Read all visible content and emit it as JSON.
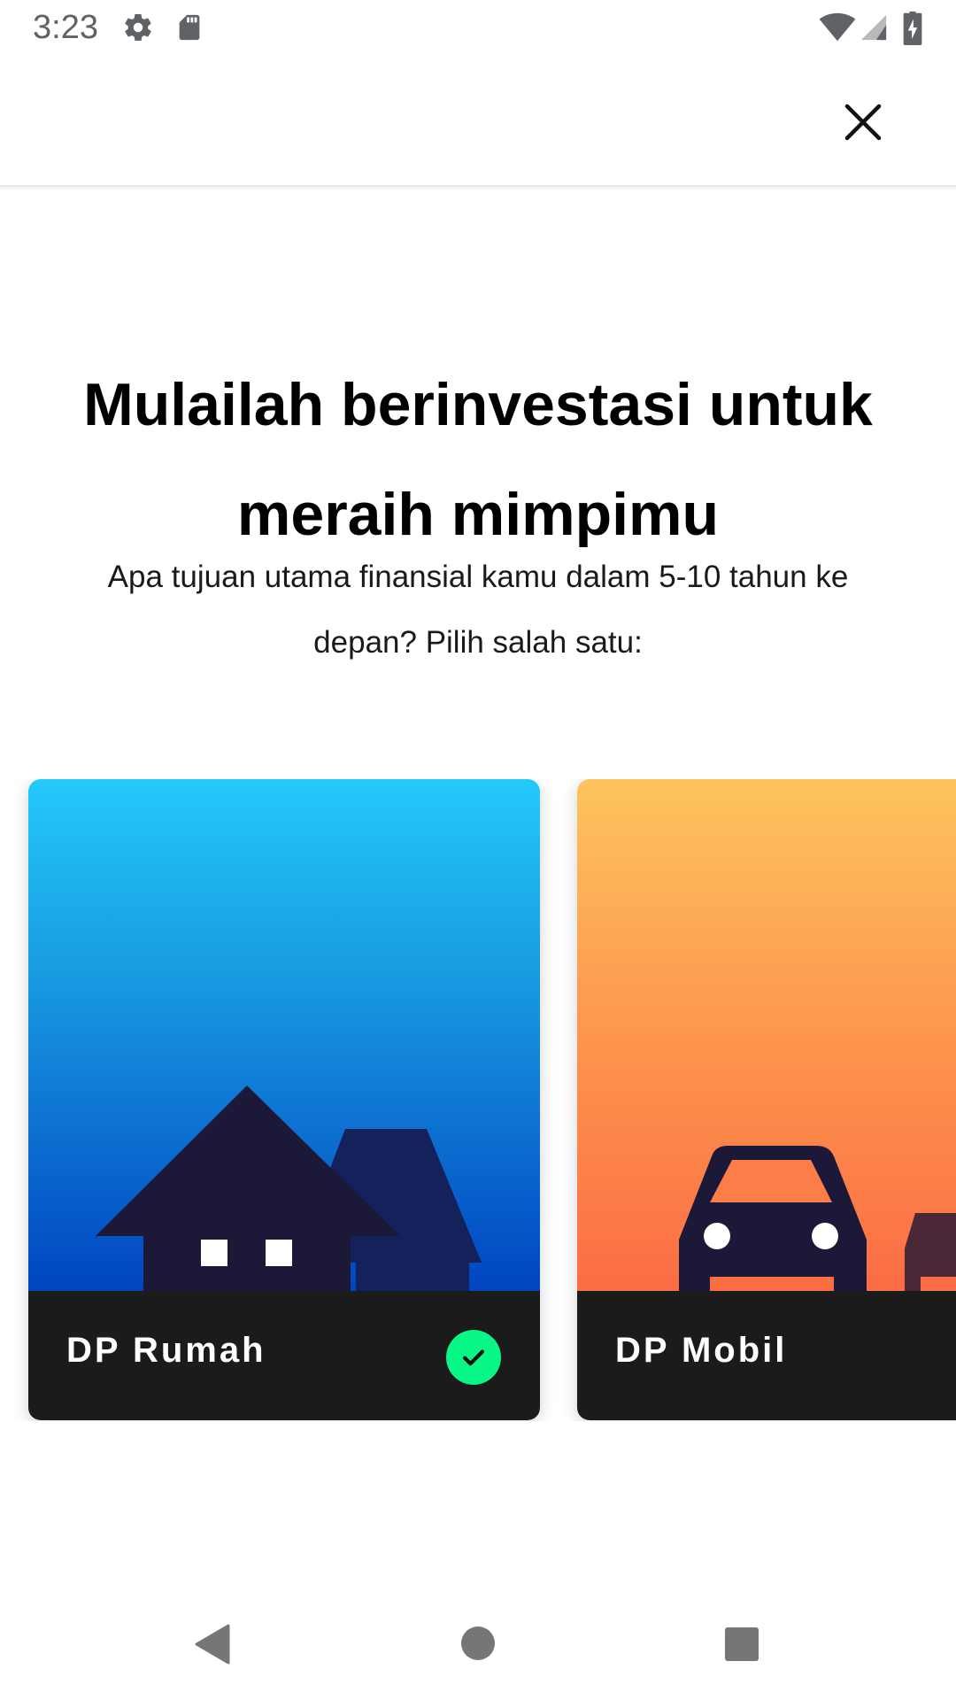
{
  "status_bar": {
    "time": "3:23",
    "icons": [
      "settings-icon",
      "sd-card-icon",
      "wifi-icon",
      "signal-icon",
      "battery-charging-icon"
    ]
  },
  "app_bar": {
    "close_icon": "close-icon"
  },
  "main": {
    "title_line1": "Mulailah berinvestasi untuk",
    "title_line2": "meraih mimpimu",
    "subtitle_line1": "Apa tujuan utama finansial kamu dalam 5-10 tahun ke",
    "subtitle_line2": "depan? Pilih salah satu:"
  },
  "goals": [
    {
      "label": "DP Rumah",
      "icon": "house-icon",
      "selected": true,
      "color_top": "#24c9fa",
      "color_bottom": "#0045c0"
    },
    {
      "label": "DP Mobil",
      "icon": "car-icon",
      "selected": false,
      "color_top": "#fdc45e",
      "color_bottom": "#fc6d44"
    }
  ],
  "colors": {
    "accent_check": "#08f787",
    "card_footer": "#1b1b1b",
    "silhouette": "#1b1838"
  },
  "nav_bar": {
    "icons": [
      "back-icon",
      "home-icon",
      "recents-icon"
    ]
  }
}
